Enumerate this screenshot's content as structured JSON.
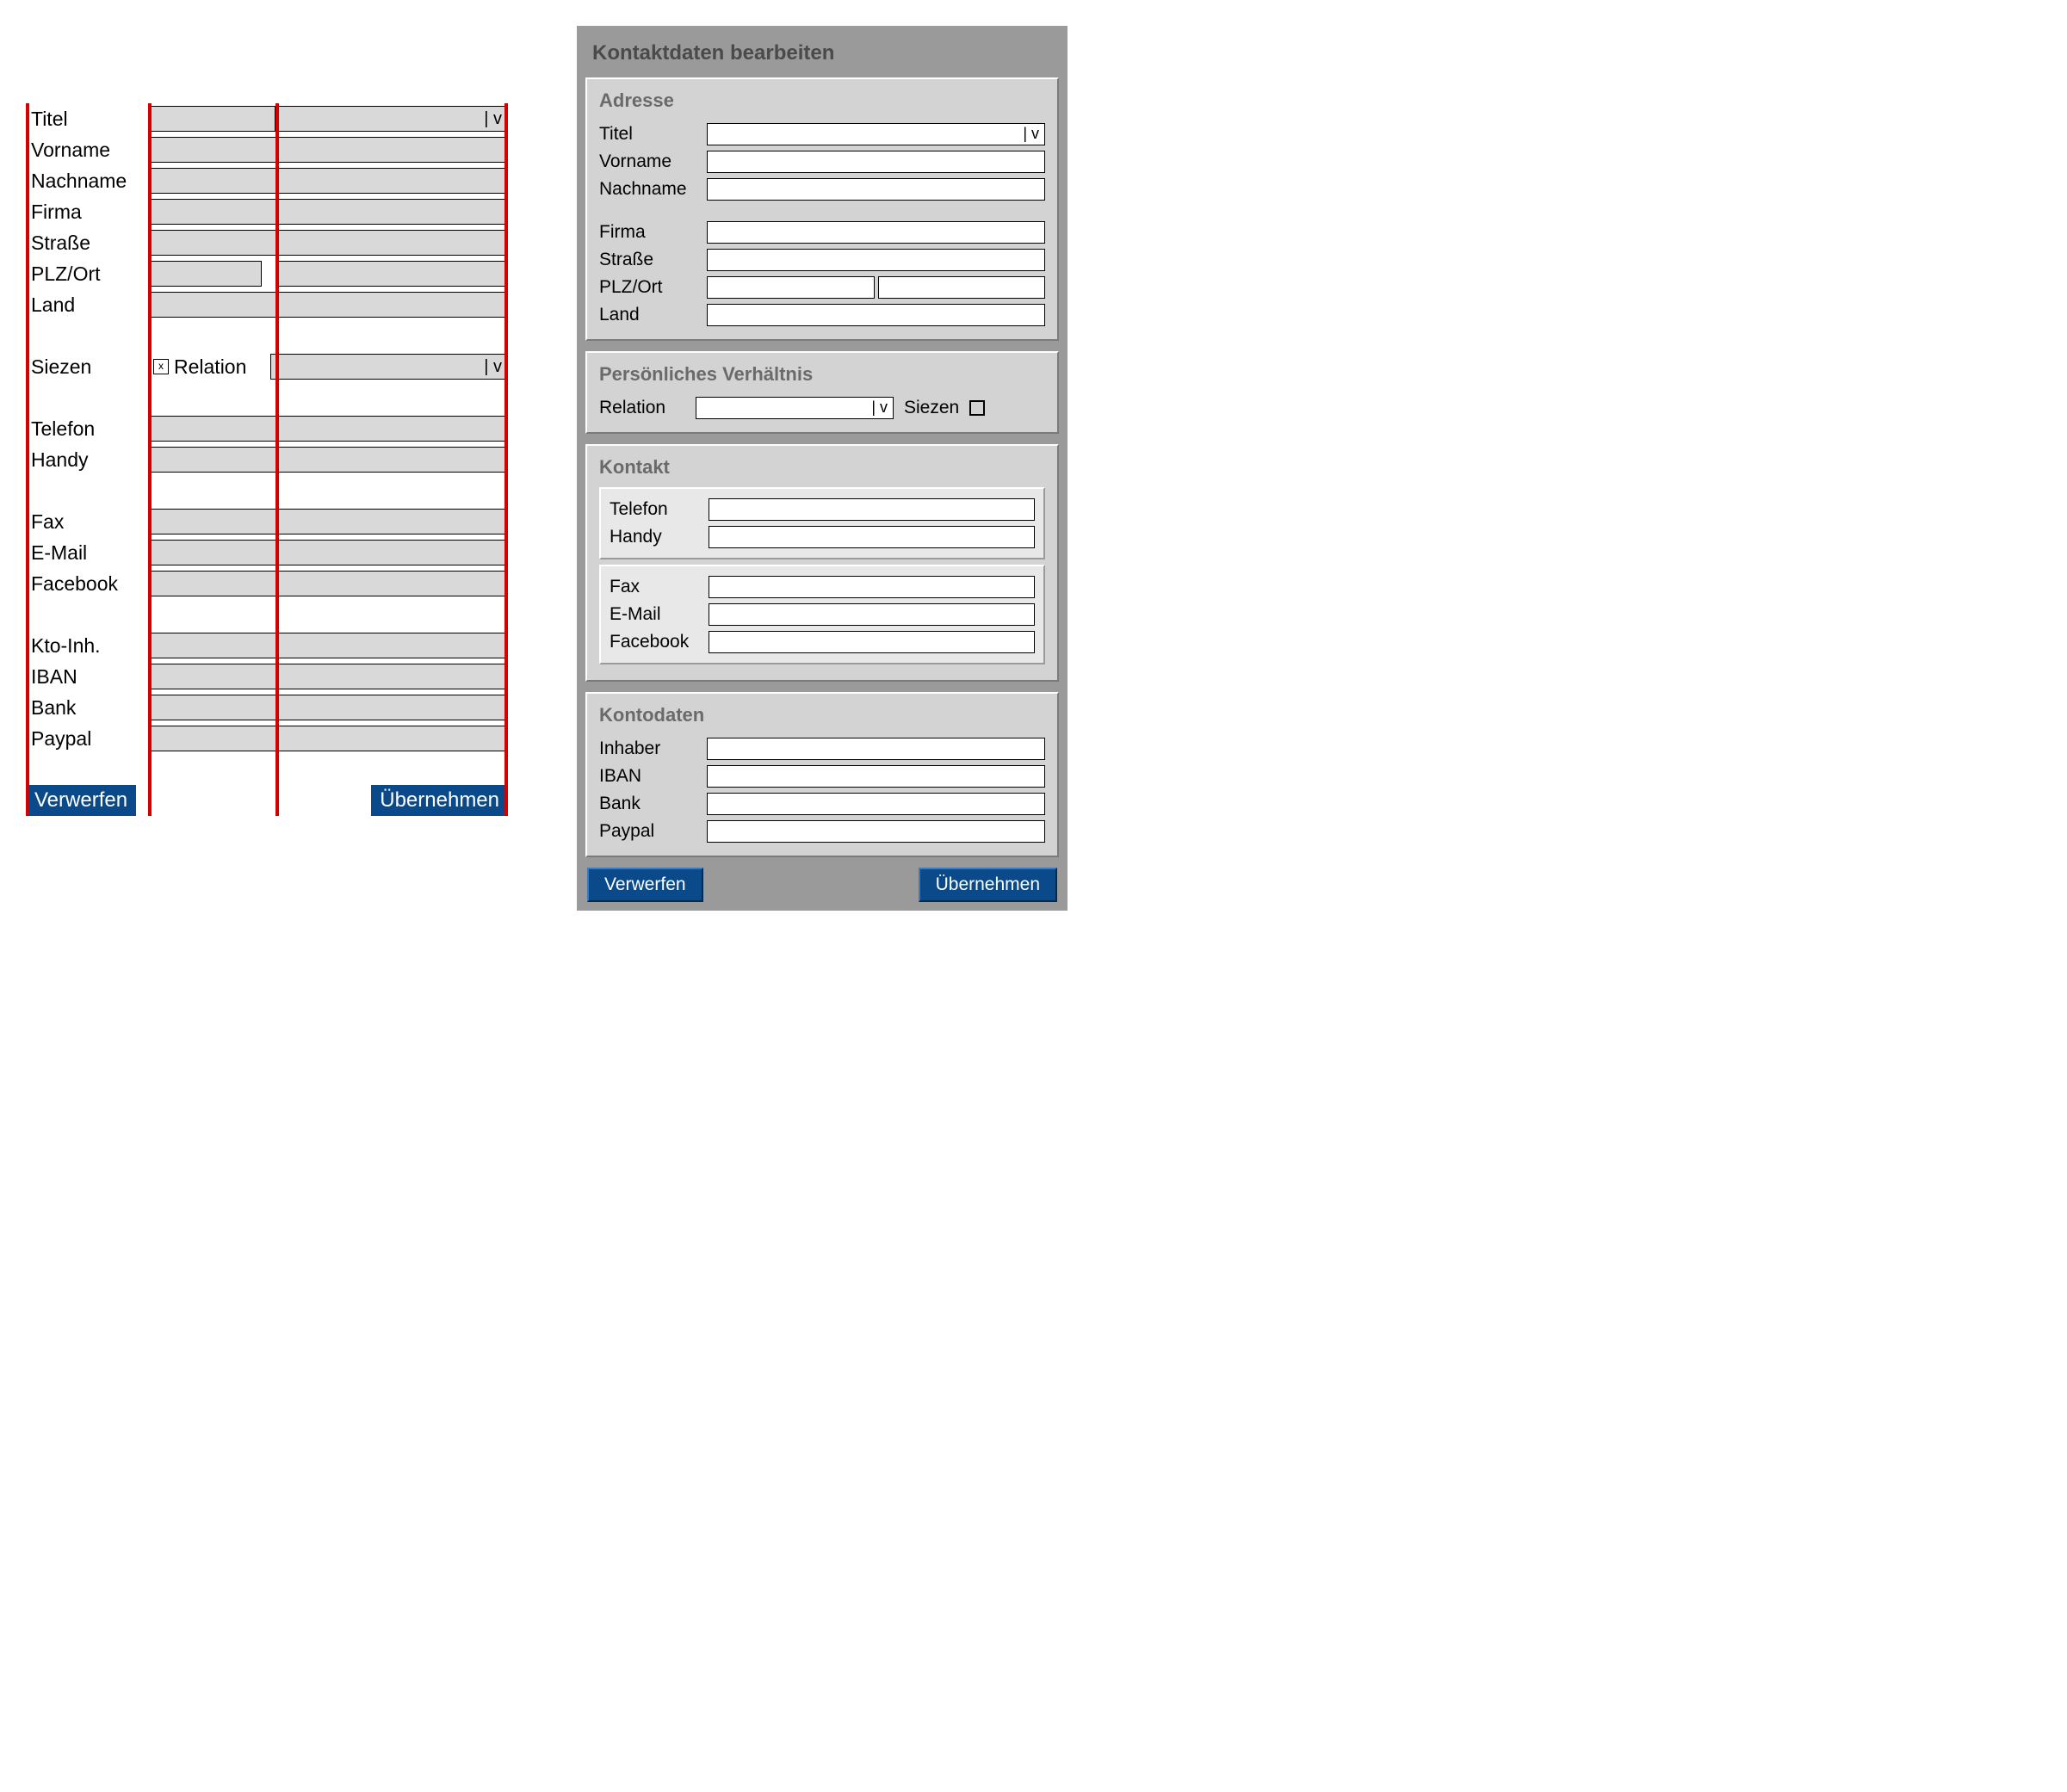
{
  "wireframe": {
    "labels": {
      "titel": "Titel",
      "vorname": "Vorname",
      "nachname": "Nachname",
      "firma": "Firma",
      "strasse": "Straße",
      "plzort": "PLZ/Ort",
      "land": "Land",
      "siezen": "Siezen",
      "relation": "Relation",
      "telefon": "Telefon",
      "handy": "Handy",
      "fax": "Fax",
      "email": "E-Mail",
      "facebook": "Facebook",
      "ktoinh": "Kto-Inh.",
      "iban": "IBAN",
      "bank": "Bank",
      "paypal": "Paypal"
    },
    "checkbox_glyph": "x",
    "dropdown_glyph": "| v",
    "buttons": {
      "discard": "Verwerfen",
      "accept": "Übernehmen"
    }
  },
  "dialog": {
    "title": "Kontaktdaten bearbeiten",
    "groups": {
      "adresse": {
        "title": "Adresse",
        "labels": {
          "titel": "Titel",
          "vorname": "Vorname",
          "nachname": "Nachname",
          "firma": "Firma",
          "strasse": "Straße",
          "plzort": "PLZ/Ort",
          "land": "Land"
        }
      },
      "verhaeltnis": {
        "title": "Persönliches Verhältnis",
        "relation_label": "Relation",
        "siezen_label": "Siezen"
      },
      "kontakt": {
        "title": "Kontakt",
        "labels": {
          "telefon": "Telefon",
          "handy": "Handy",
          "fax": "Fax",
          "email": "E-Mail",
          "facebook": "Facebook"
        }
      },
      "kontodaten": {
        "title": "Kontodaten",
        "labels": {
          "inhaber": "Inhaber",
          "iban": "IBAN",
          "bank": "Bank",
          "paypal": "Paypal"
        }
      }
    },
    "dropdown_glyph": "| v",
    "buttons": {
      "discard": "Verwerfen",
      "accept": "Übernehmen"
    }
  }
}
